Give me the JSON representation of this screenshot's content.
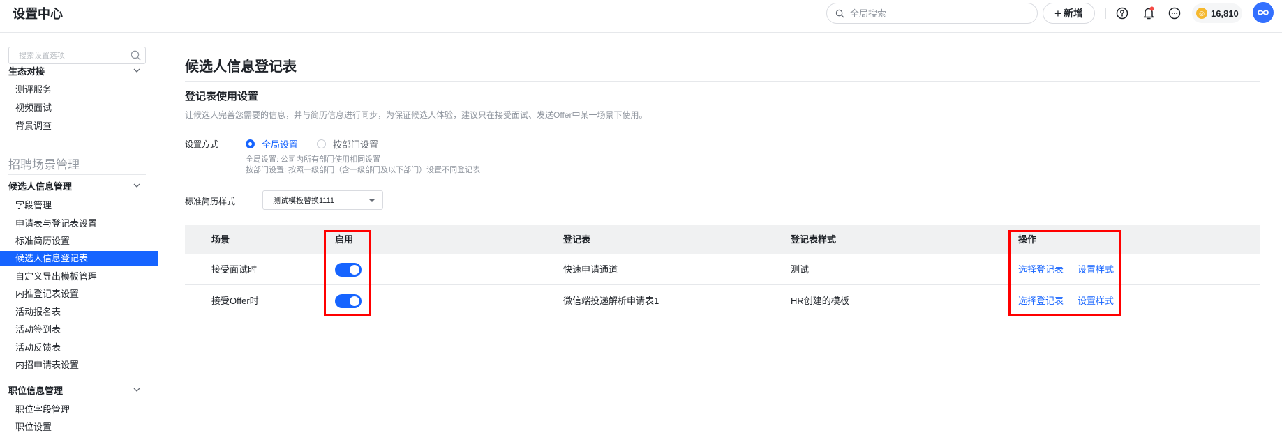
{
  "topbar": {
    "title": "设置中心",
    "search_placeholder": "全局搜索",
    "add_label": "新增",
    "coins": "16,810"
  },
  "sidebar": {
    "search_placeholder": "搜索设置选项",
    "group_eco": "生态对接",
    "eco_items": [
      "测评服务",
      "视频面试",
      "背景调查"
    ],
    "section_recruit": "招聘场景管理",
    "group_candidate": "候选人信息管理",
    "candidate_items": [
      "字段管理",
      "申请表与登记表设置",
      "标准简历设置",
      "候选人信息登记表",
      "自定义导出模板管理",
      "内推登记表设置",
      "活动报名表",
      "活动签到表",
      "活动反馈表",
      "内招申请表设置"
    ],
    "active_item": "候选人信息登记表",
    "group_position": "职位信息管理",
    "position_items": [
      "职位字段管理",
      "职位设置"
    ]
  },
  "main": {
    "page_title": "候选人信息登记表",
    "section_title": "登记表使用设置",
    "section_desc": "让候选人完善您需要的信息，并与简历信息进行同步，为保证候选人体验，建议只在接受面试、发送Offer中某一场景下使用。",
    "mode_label": "设置方式",
    "mode_global": "全局设置",
    "mode_dept": "按部门设置",
    "hint_global": "全局设置: 公司内所有部门使用相同设置",
    "hint_dept": "按部门设置: 按照一级部门（含一级部门及以下部门）设置不同登记表",
    "resume_label": "标准简历样式",
    "resume_value": "测试模板替换1111"
  },
  "table": {
    "headers": {
      "scene": "场景",
      "enable": "启用",
      "form": "登记表",
      "style": "登记表样式",
      "ops": "操作"
    },
    "rows": [
      {
        "scene": "接受面试时",
        "enabled": true,
        "form": "快速申请通道",
        "style": "测试",
        "op1": "选择登记表",
        "op2": "设置样式"
      },
      {
        "scene": "接受Offer时",
        "enabled": true,
        "form": "微信端投递解析申请表1",
        "style": "HR创建的模板",
        "op1": "选择登记表",
        "op2": "设置样式"
      }
    ]
  },
  "colors": {
    "accent": "#1664ff",
    "highlight": "#ff0000",
    "coin": "#f5b82e"
  }
}
